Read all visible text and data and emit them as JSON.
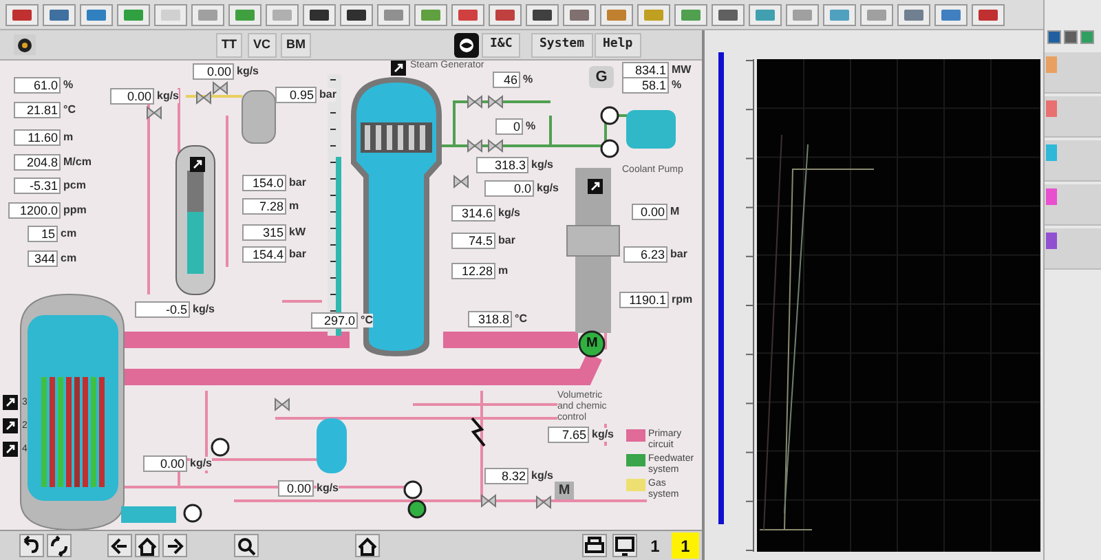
{
  "menu_tabs": [
    {
      "label": "TT"
    },
    {
      "label": "VC"
    },
    {
      "label": "BM"
    }
  ],
  "menus": [
    {
      "label": "I&C"
    },
    {
      "label": "System"
    },
    {
      "label": "Help"
    }
  ],
  "labels": [
    {
      "text": "Steam Generator"
    },
    {
      "text": "Coolant Pump"
    },
    {
      "text": "Volumetric and chemic control"
    }
  ],
  "readings": [
    {
      "value": "61.0",
      "unit": "%"
    },
    {
      "value": "21.81",
      "unit": "°C"
    },
    {
      "value": "11.60",
      "unit": "m"
    },
    {
      "value": "204.8",
      "unit": "M/cm"
    },
    {
      "value": "-5.31",
      "unit": "pcm"
    },
    {
      "value": "1200.0",
      "unit": "ppm"
    },
    {
      "value": "15",
      "unit": "cm"
    },
    {
      "value": "344",
      "unit": "cm"
    },
    {
      "value": "0.00",
      "unit": "kg/s"
    },
    {
      "value": "0.00",
      "unit": "kg/s"
    },
    {
      "value": "0.95",
      "unit": "bar"
    },
    {
      "value": "46",
      "unit": "%"
    },
    {
      "value": "834.1",
      "unit": "MW"
    },
    {
      "value": "58.1",
      "unit": "%"
    },
    {
      "value": "0",
      "unit": "%"
    },
    {
      "value": "154.0",
      "unit": "bar"
    },
    {
      "value": "7.28",
      "unit": "m"
    },
    {
      "value": "315",
      "unit": "kW"
    },
    {
      "value": "154.4",
      "unit": "bar"
    },
    {
      "value": "318.3",
      "unit": "kg/s"
    },
    {
      "value": "0.0",
      "unit": "kg/s"
    },
    {
      "value": "314.6",
      "unit": "kg/s"
    },
    {
      "value": "74.5",
      "unit": "bar"
    },
    {
      "value": "12.28",
      "unit": "m"
    },
    {
      "value": "0.00",
      "unit": "M"
    },
    {
      "value": "6.23",
      "unit": "bar"
    },
    {
      "value": "-0.5",
      "unit": "kg/s"
    },
    {
      "value": "297.0",
      "unit": "°C"
    },
    {
      "value": "318.8",
      "unit": "°C"
    },
    {
      "value": "1190.1",
      "unit": "rpm"
    },
    {
      "value": "7.65",
      "unit": "kg/s"
    },
    {
      "value": "0.00",
      "unit": "kg/s"
    },
    {
      "value": "8.32",
      "unit": "kg/s"
    },
    {
      "value": "0.00",
      "unit": "kg/s"
    }
  ],
  "pumps": [
    {
      "on": false
    },
    {
      "on": false
    },
    {
      "on": false
    },
    {
      "on": false
    },
    {
      "on": false
    },
    {
      "on": true
    },
    {
      "on": true,
      "label": "M"
    }
  ],
  "generator": {
    "label": "G"
  },
  "valve_motor": {
    "label": "M"
  },
  "group_buttons": [
    {
      "label": "3"
    },
    {
      "label": "2"
    },
    {
      "label": "4"
    }
  ],
  "legend": [
    {
      "text": "Primary circuit",
      "color": "#e06a98"
    },
    {
      "text": "Feedwater system",
      "color": "#3aa54a"
    },
    {
      "text": "Gas system",
      "color": "#eee070"
    }
  ],
  "page_counters": [
    {
      "text": "1",
      "highlighted": false
    },
    {
      "text": "1",
      "highlighted": true
    }
  ],
  "trends": [
    {
      "color": "#e8a060"
    },
    {
      "color": "#e87070"
    },
    {
      "color": "#30b8d8"
    },
    {
      "color": "#e850d0"
    },
    {
      "color": "#9050d0"
    }
  ]
}
